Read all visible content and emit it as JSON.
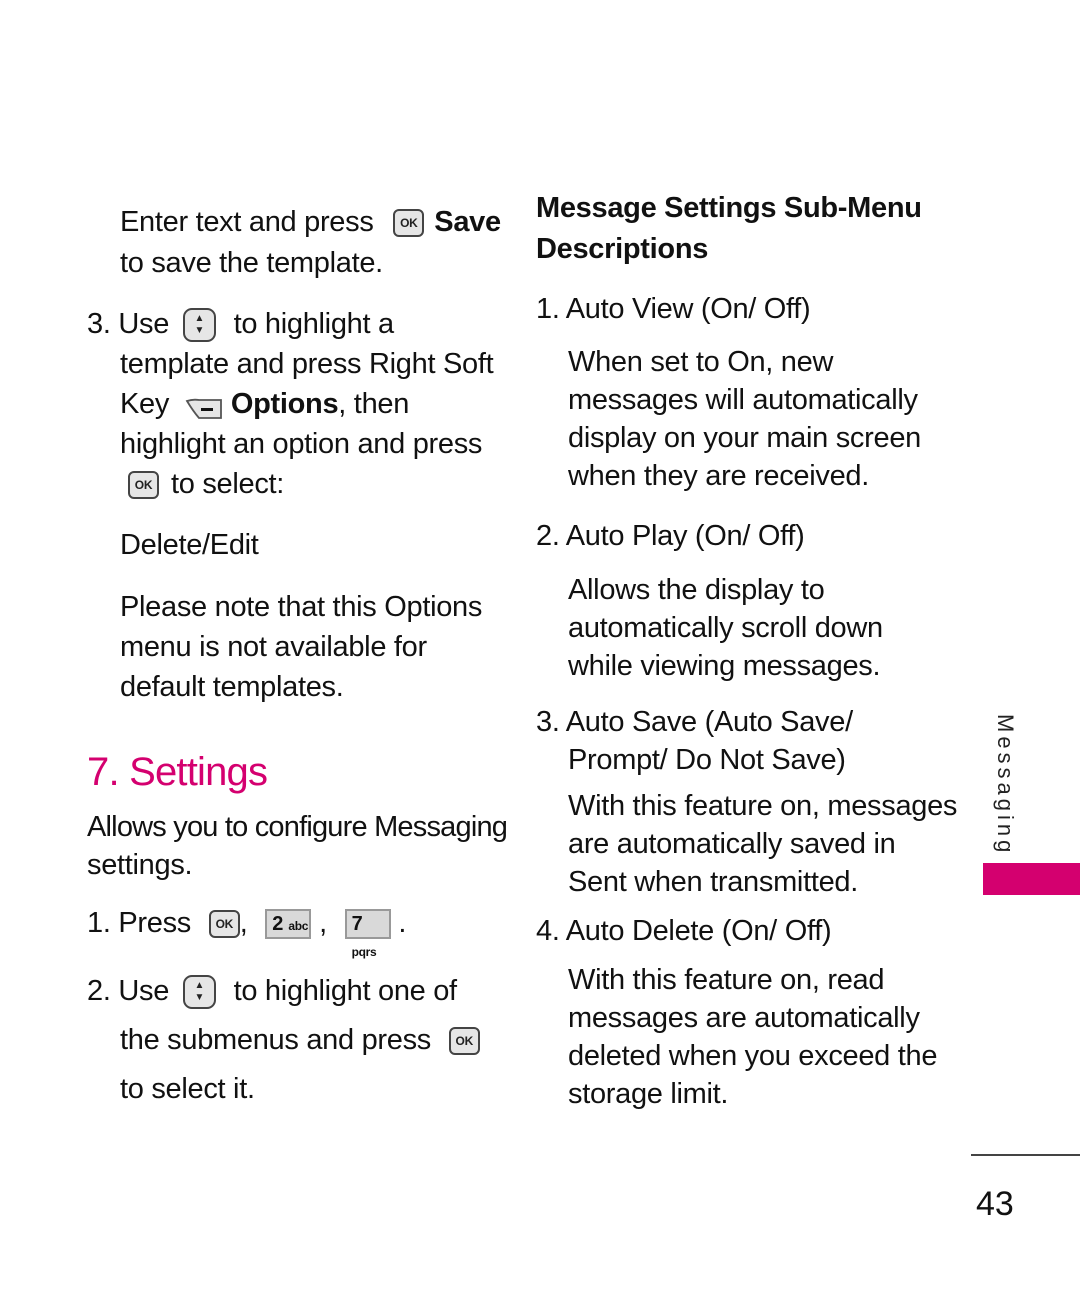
{
  "left": {
    "intro_line1_a": "Enter text and press",
    "intro_line1_b": "Save",
    "intro_line2": "to save the template.",
    "step3": {
      "number": "3.",
      "use": "Use",
      "text1": "to highlight a",
      "text2": "template and press Right Soft",
      "text3_key": "Key",
      "text3_bold": "Options",
      "text3_rest": ", then",
      "text4": "highlight an option and press",
      "text5": "to select:"
    },
    "option_label": "Delete/Edit",
    "note_lines": [
      "Please note that this Options",
      "menu is not available for",
      "default templates."
    ],
    "section_title": "7. Settings",
    "section_desc_lines": [
      "Allows you to configure Messaging",
      "settings."
    ],
    "steps": {
      "s1_number": "1.",
      "s1_text": "Press",
      "comma": ",",
      "period": ".",
      "s2_number": "2.",
      "s2_use": "Use",
      "s2_text1": "to highlight one of",
      "s2_text2": "the submenus and press",
      "s2_text3": "to select it."
    }
  },
  "keys": {
    "ok": "OK",
    "nav_up": "▲",
    "nav_down": "▼",
    "key2_num": "2",
    "key2_letters": "abc",
    "key7_num": "7",
    "key7_letters": "pqrs",
    "soft_minus": "–"
  },
  "right": {
    "heading_lines": [
      "Message Settings Sub-Menu",
      "Descriptions"
    ],
    "items": [
      {
        "title": "1. Auto View (On/ Off)",
        "desc": [
          "When set to On, new",
          "messages will automatically",
          "display on your main screen",
          "when they are received."
        ]
      },
      {
        "title": "2. Auto Play (On/ Off)",
        "desc": [
          "Allows the display to",
          "automatically scroll down",
          "while viewing messages."
        ]
      },
      {
        "title_lines": [
          "3. Auto Save (Auto Save/",
          "Prompt/ Do Not Save)"
        ],
        "desc": [
          "With this feature on, messages",
          "are automatically saved in",
          "Sent when transmitted."
        ]
      },
      {
        "title": "4. Auto Delete (On/ Off)",
        "desc": [
          "With this feature on, read",
          "messages are automatically",
          "deleted when you exceed the",
          "storage limit."
        ]
      }
    ]
  },
  "side_tab": {
    "label": "Messaging",
    "color": "#d4006f"
  },
  "page_number": "43"
}
